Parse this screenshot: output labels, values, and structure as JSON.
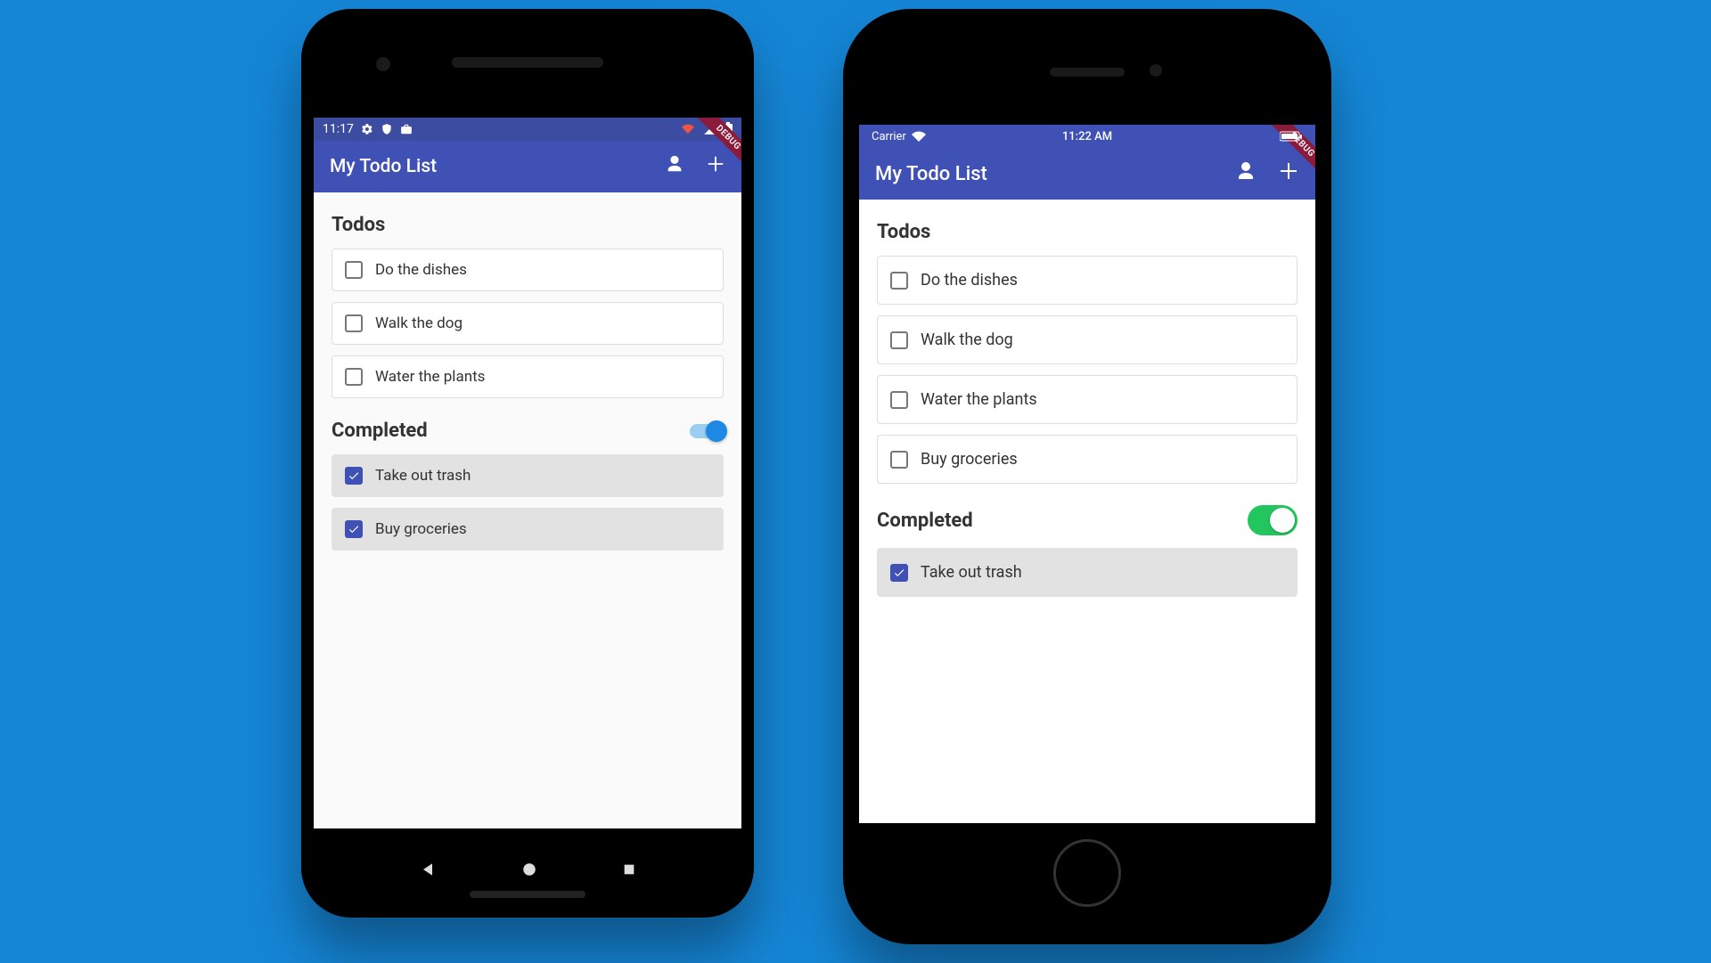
{
  "debugBannerText": "DEBUG",
  "android": {
    "status": {
      "time": "11:17"
    },
    "appbar": {
      "title": "My Todo List"
    },
    "sectionTodosTitle": "Todos",
    "sectionCompletedTitle": "Completed",
    "completedToggle": true,
    "todos": [
      {
        "label": "Do the dishes",
        "checked": false
      },
      {
        "label": "Walk the dog",
        "checked": false
      },
      {
        "label": "Water the plants",
        "checked": false
      }
    ],
    "completed": [
      {
        "label": "Take out trash",
        "checked": true
      },
      {
        "label": "Buy groceries",
        "checked": true
      }
    ]
  },
  "ios": {
    "status": {
      "carrier": "Carrier",
      "time": "11:22 AM"
    },
    "appbar": {
      "title": "My Todo List"
    },
    "sectionTodosTitle": "Todos",
    "sectionCompletedTitle": "Completed",
    "completedToggle": true,
    "todos": [
      {
        "label": "Do the dishes",
        "checked": false
      },
      {
        "label": "Walk the dog",
        "checked": false
      },
      {
        "label": "Water the plants",
        "checked": false
      },
      {
        "label": "Buy groceries",
        "checked": false
      }
    ],
    "completed": [
      {
        "label": "Take out trash",
        "checked": true
      }
    ]
  }
}
